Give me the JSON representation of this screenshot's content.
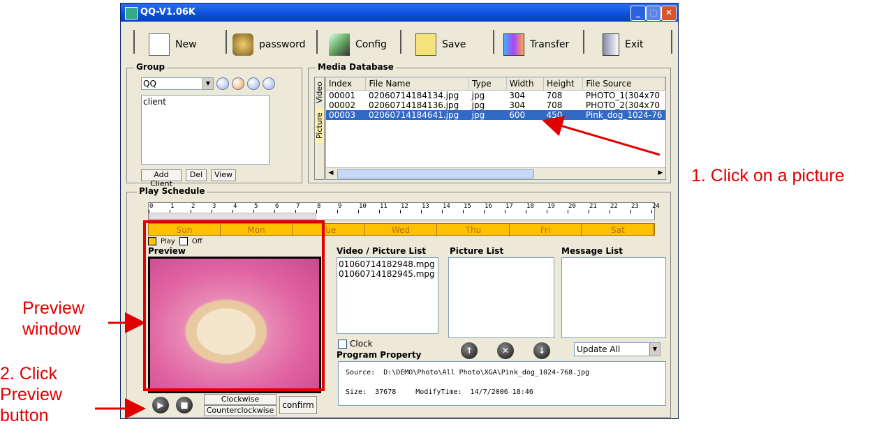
{
  "window": {
    "title": "QQ-V1.06K"
  },
  "toolbar": {
    "new": "New",
    "password": "password",
    "config": "Config",
    "save": "Save",
    "transfer": "Transfer",
    "exit": "Exit"
  },
  "group": {
    "legend": "Group",
    "select_value": "QQ",
    "clients": [
      "client"
    ],
    "add_client": "Add Client",
    "del": "Del",
    "view": "View"
  },
  "media": {
    "legend": "Media Database",
    "tabs": [
      "Video",
      "Picture"
    ],
    "columns": [
      "Index",
      "File Name",
      "Type",
      "Width",
      "Height",
      "File Source"
    ],
    "rows": [
      [
        "00001",
        "02060714184134.jpg",
        "jpg",
        "304",
        "708",
        "PHOTO_1(304x70"
      ],
      [
        "00002",
        "02060714184136.jpg",
        "jpg",
        "304",
        "708",
        "PHOTO_2(304x70"
      ],
      [
        "00003",
        "02060714184641.jpg",
        "jpg",
        "600",
        "450",
        "Pink_dog_1024-76"
      ]
    ]
  },
  "schedule": {
    "legend": "Play Schedule",
    "hours": [
      "0",
      "1",
      "2",
      "3",
      "4",
      "5",
      "6",
      "7",
      "8",
      "9",
      "10",
      "11",
      "12",
      "13",
      "14",
      "15",
      "16",
      "17",
      "18",
      "19",
      "20",
      "21",
      "22",
      "23",
      "24"
    ],
    "days": [
      "Sun",
      "Mon",
      "Tue",
      "Wed",
      "Thu",
      "Fri",
      "Sat"
    ],
    "play": "Play",
    "off": "Off"
  },
  "preview": {
    "label": "Preview"
  },
  "lists": {
    "video_picture": "Video / Picture List",
    "video_items": [
      "01060714182948.mpg",
      "01060714182945.mpg"
    ],
    "picture": "Picture List",
    "message": "Message List",
    "clock": "Clock",
    "update_select": "Update All"
  },
  "program": {
    "label": "Program Property",
    "source_label": "Source:",
    "source_value": "D:\\DEMO\\Photo\\All Photo\\XGA\\Pink_dog_1024-768.jpg",
    "size_label": "Size:",
    "size_value": "37678",
    "modify_label": "ModifyTime:",
    "modify_value": "14/7/2006 18:46"
  },
  "controls": {
    "clockwise": "Clockwise",
    "counterclockwise": "Counterclockwise",
    "confirm": "confirm"
  },
  "annotations": {
    "click_picture": "1. Click on a picture",
    "preview_window_1": "Preview",
    "preview_window_2": "window",
    "click_preview_1": "2. Click",
    "click_preview_2": "Preview",
    "click_preview_3": "button"
  },
  "colors": {
    "annotation": "#e00000",
    "selection": "#316ac5",
    "day_bar": "#ffc000"
  }
}
